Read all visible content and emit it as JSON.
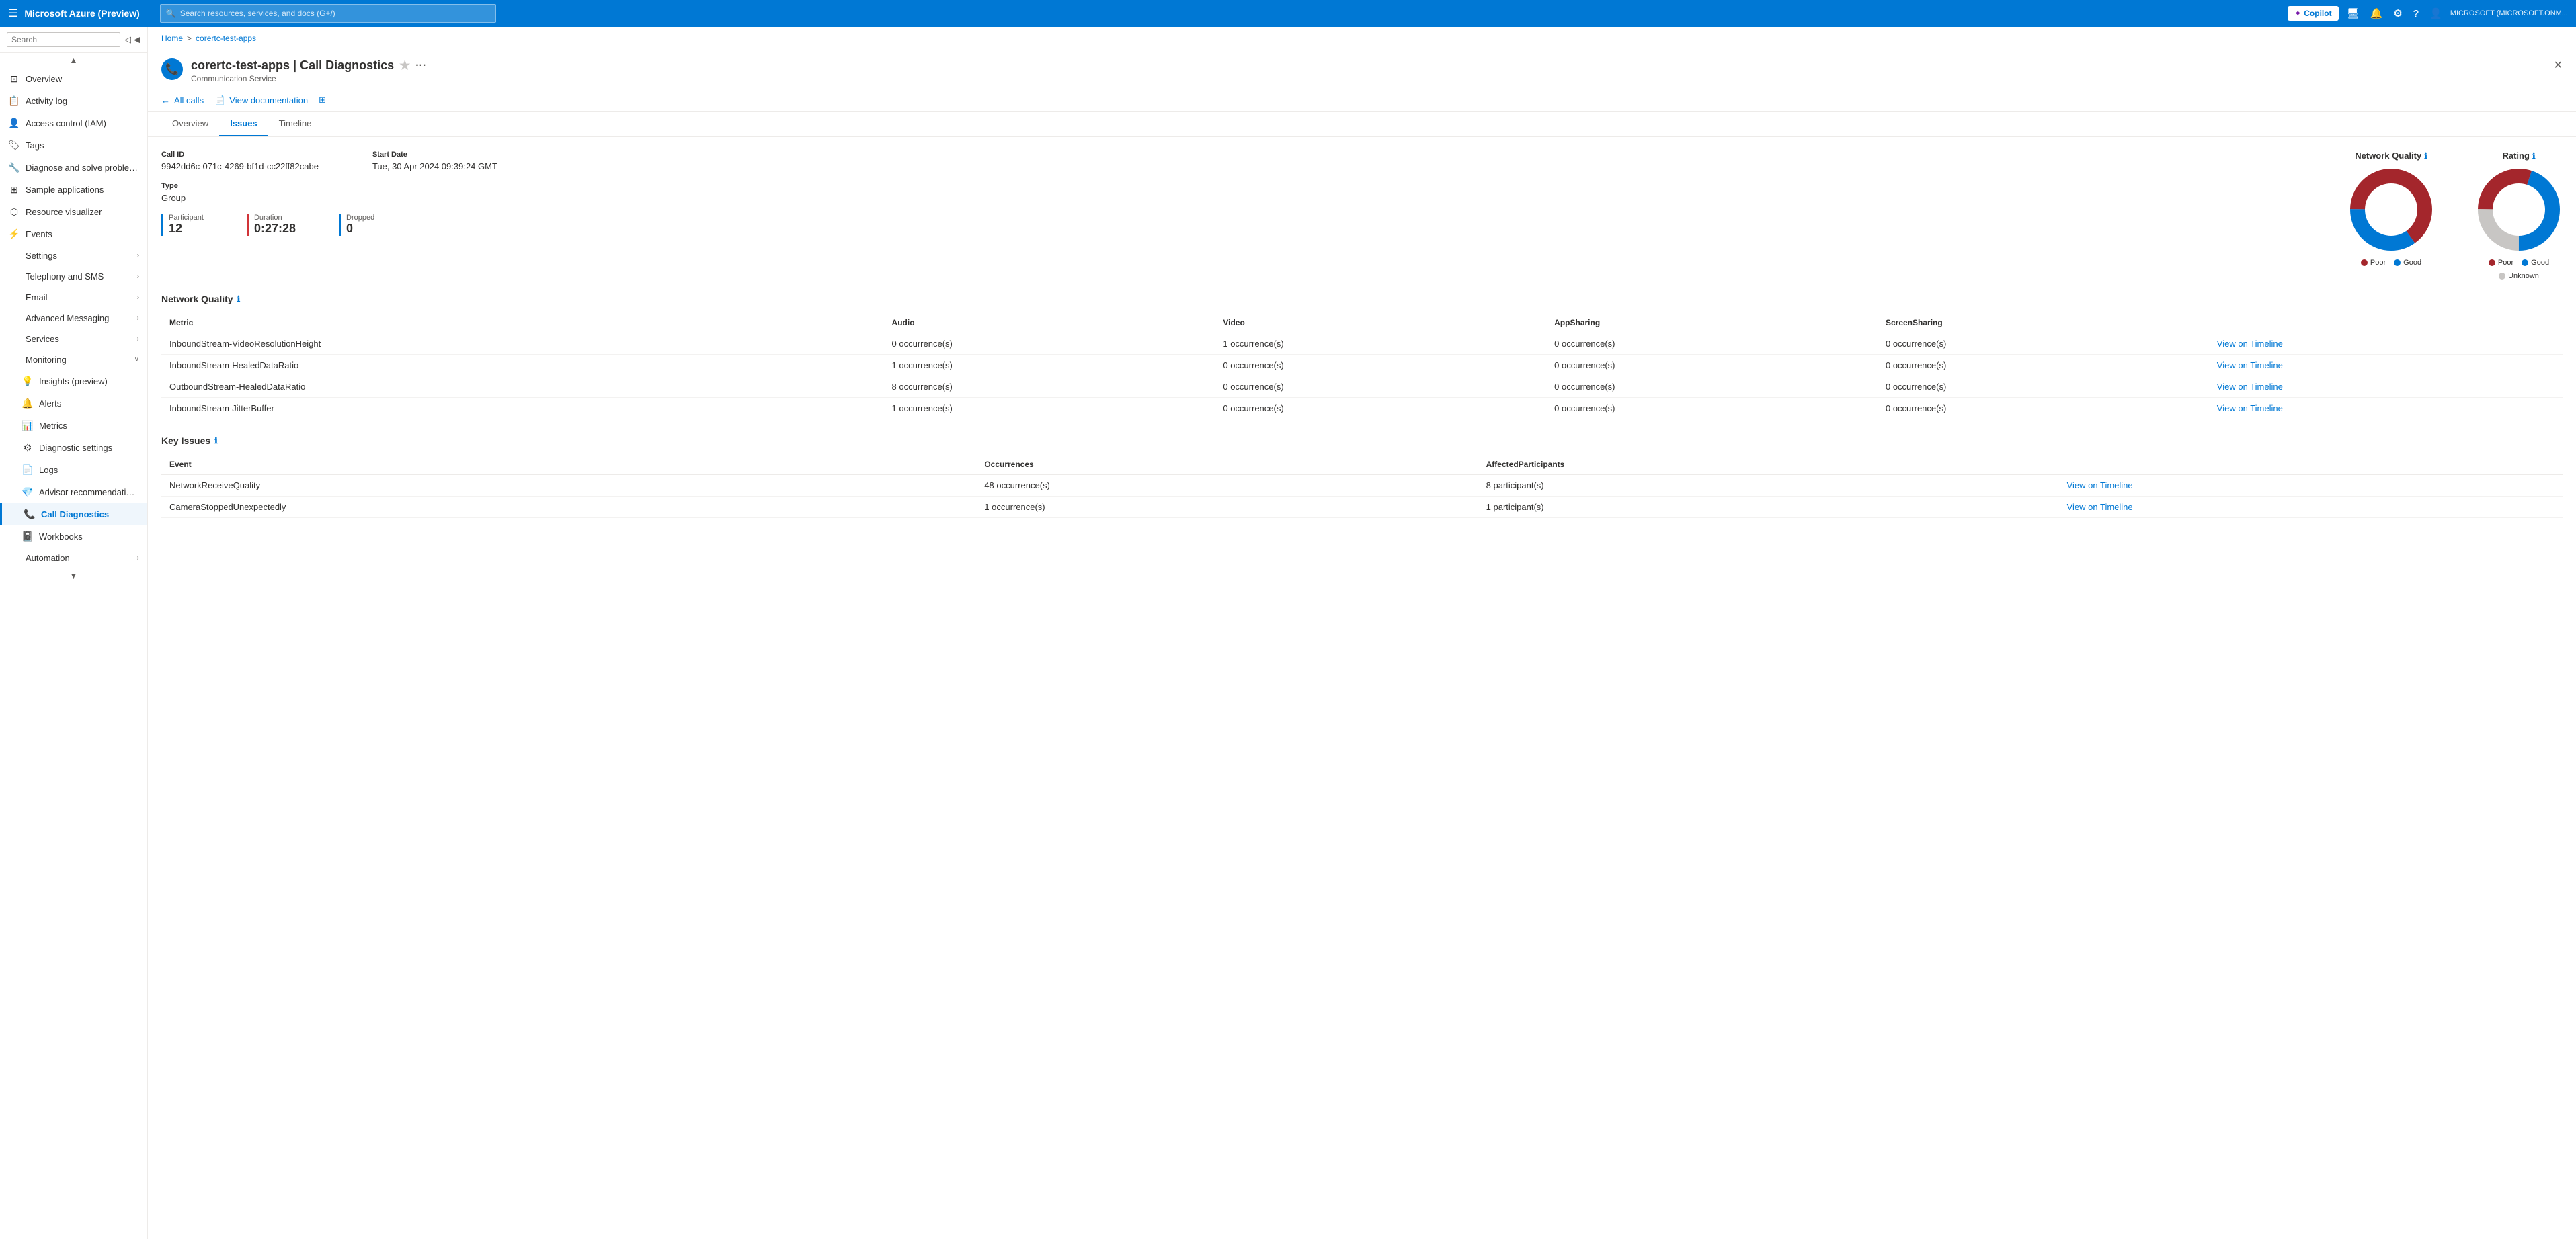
{
  "topnav": {
    "hamburger": "☰",
    "title": "Microsoft Azure (Preview)",
    "search_placeholder": "Search resources, services, and docs (G+/)",
    "copilot_label": "Copilot",
    "user_label": "MICROSOFT (MICROSOFT.ONM..."
  },
  "breadcrumb": {
    "home": "Home",
    "separator": ">",
    "resource": "corertc-test-apps"
  },
  "resource": {
    "title": "corertc-test-apps | Call Diagnostics",
    "subtitle": "Communication Service",
    "close_icon": "✕"
  },
  "toolbar": {
    "back_label": "All calls",
    "doc_label": "View documentation"
  },
  "tabs": {
    "items": [
      {
        "label": "Overview",
        "active": false
      },
      {
        "label": "Issues",
        "active": true
      },
      {
        "label": "Timeline",
        "active": false
      }
    ]
  },
  "call_info": {
    "call_id_label": "Call ID",
    "call_id_value": "9942dd6c-071c-4269-bf1d-cc22ff82cabe",
    "start_date_label": "Start Date",
    "start_date_value": "Tue, 30 Apr 2024 09:39:24 GMT",
    "type_label": "Type",
    "type_value": "Group"
  },
  "stats": [
    {
      "label": "Participant",
      "value": "12",
      "border_color": "#0078d4"
    },
    {
      "label": "Duration",
      "value": "0:27:28",
      "border_color": "#d13438"
    },
    {
      "label": "Dropped",
      "value": "0",
      "border_color": "#0078d4"
    }
  ],
  "network_quality": {
    "title": "Network Quality",
    "columns": [
      "Metric",
      "Audio",
      "Video",
      "AppSharing",
      "ScreenSharing",
      ""
    ],
    "rows": [
      {
        "metric": "InboundStream-VideoResolutionHeight",
        "audio": "0 occurrence(s)",
        "video": "1 occurrence(s)",
        "appsharing": "0 occurrence(s)",
        "screensharing": "0 occurrence(s)"
      },
      {
        "metric": "InboundStream-HealedDataRatio",
        "audio": "1 occurrence(s)",
        "video": "0 occurrence(s)",
        "appsharing": "0 occurrence(s)",
        "screensharing": "0 occurrence(s)"
      },
      {
        "metric": "OutboundStream-HealedDataRatio",
        "audio": "8 occurrence(s)",
        "video": "0 occurrence(s)",
        "appsharing": "0 occurrence(s)",
        "screensharing": "0 occurrence(s)"
      },
      {
        "metric": "InboundStream-JitterBuffer",
        "audio": "1 occurrence(s)",
        "video": "0 occurrence(s)",
        "appsharing": "0 occurrence(s)",
        "screensharing": "0 occurrence(s)"
      }
    ],
    "view_timeline_label": "View on Timeline"
  },
  "key_issues": {
    "title": "Key Issues",
    "columns": [
      "Event",
      "Occurrences",
      "AffectedParticipants",
      ""
    ],
    "rows": [
      {
        "event": "NetworkReceiveQuality",
        "occurrences": "48 occurrence(s)",
        "affected": "8 participant(s)"
      },
      {
        "event": "CameraStoppedUnexpectedly",
        "occurrences": "1 occurrence(s)",
        "affected": "1 participant(s)"
      }
    ],
    "view_timeline_label": "View on Timeline"
  },
  "network_quality_chart": {
    "title": "Network Quality",
    "poor_pct": 65,
    "good_pct": 35,
    "legend": [
      {
        "label": "Poor",
        "color": "#a4262c"
      },
      {
        "label": "Good",
        "color": "#0078d4"
      }
    ]
  },
  "rating_chart": {
    "title": "Rating",
    "poor_pct": 30,
    "good_pct": 45,
    "unknown_pct": 25,
    "legend": [
      {
        "label": "Poor",
        "color": "#a4262c"
      },
      {
        "label": "Good",
        "color": "#0078d4"
      },
      {
        "label": "Unknown",
        "color": "#c8c6c4"
      }
    ]
  },
  "sidebar": {
    "search_placeholder": "Search",
    "items": [
      {
        "label": "Overview",
        "icon": "⊡",
        "active": false,
        "indent": false
      },
      {
        "label": "Activity log",
        "icon": "📋",
        "active": false,
        "indent": false
      },
      {
        "label": "Access control (IAM)",
        "icon": "👤",
        "active": false,
        "indent": false
      },
      {
        "label": "Tags",
        "icon": "🏷",
        "active": false,
        "indent": false
      },
      {
        "label": "Diagnose and solve problems",
        "icon": "🔧",
        "active": false,
        "indent": false
      },
      {
        "label": "Sample applications",
        "icon": "⊞",
        "active": false,
        "indent": false
      },
      {
        "label": "Resource visualizer",
        "icon": "⬡",
        "active": false,
        "indent": false
      },
      {
        "label": "Events",
        "icon": "⚡",
        "active": false,
        "indent": false,
        "chevron": false
      },
      {
        "label": "Settings",
        "icon": "",
        "active": false,
        "indent": false,
        "chevron": true
      },
      {
        "label": "Telephony and SMS",
        "icon": "",
        "active": false,
        "indent": false,
        "chevron": true
      },
      {
        "label": "Email",
        "icon": "",
        "active": false,
        "indent": false,
        "chevron": true
      },
      {
        "label": "Advanced Messaging",
        "icon": "",
        "active": false,
        "indent": false,
        "chevron": true
      },
      {
        "label": "Services",
        "icon": "",
        "active": false,
        "indent": false,
        "chevron": true
      },
      {
        "label": "Monitoring",
        "icon": "",
        "active": false,
        "indent": false,
        "chevron": false,
        "expanded": true
      },
      {
        "label": "Insights (preview)",
        "icon": "💡",
        "active": false,
        "indent": true
      },
      {
        "label": "Alerts",
        "icon": "🔔",
        "active": false,
        "indent": true
      },
      {
        "label": "Metrics",
        "icon": "📊",
        "active": false,
        "indent": true
      },
      {
        "label": "Diagnostic settings",
        "icon": "⚙",
        "active": false,
        "indent": true
      },
      {
        "label": "Logs",
        "icon": "📄",
        "active": false,
        "indent": true
      },
      {
        "label": "Advisor recommendations",
        "icon": "💎",
        "active": false,
        "indent": true
      },
      {
        "label": "Call Diagnostics",
        "icon": "📞",
        "active": true,
        "indent": true
      },
      {
        "label": "Workbooks",
        "icon": "📓",
        "active": false,
        "indent": true
      },
      {
        "label": "Automation",
        "icon": "",
        "active": false,
        "indent": false,
        "chevron": true
      }
    ]
  }
}
